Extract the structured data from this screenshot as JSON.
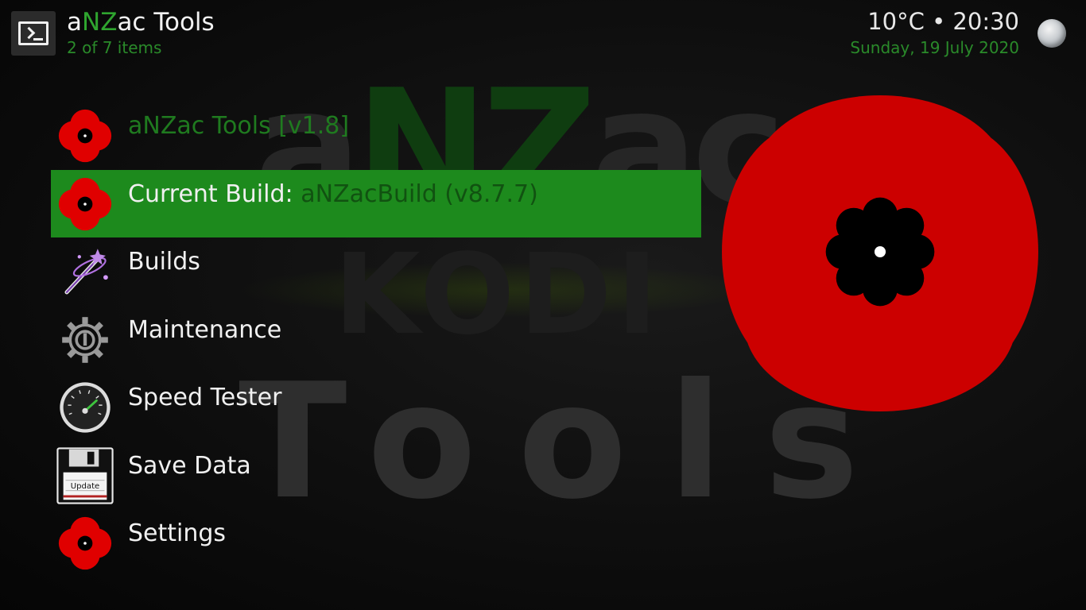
{
  "header": {
    "title_prefix": "a",
    "title_accent": "NZ",
    "title_suffix": "ac Tools",
    "item_count": "2 of 7 items",
    "weather_time": "10°C • 20:30",
    "date": "Sunday, 19 July 2020",
    "icons": {
      "app": "terminal-icon",
      "weather": "moon-icon"
    }
  },
  "fanart": {
    "top_prefix": "a",
    "top_accent": "NZ",
    "top_suffix": "ac",
    "middle": "KODI",
    "bottom": "Tools"
  },
  "menu": {
    "items": [
      {
        "label": "aNZac Tools [v1.8]",
        "icon": "poppy-icon"
      },
      {
        "label": "Current Build:",
        "label_dim": "aNZacBuild (v8.7.7)",
        "icon": "poppy-icon",
        "focused": true
      },
      {
        "label": "Builds",
        "icon": "magic-wand-icon"
      },
      {
        "label": "Maintenance",
        "icon": "gear-wrench-icon"
      },
      {
        "label": "Speed Tester",
        "icon": "speedometer-icon"
      },
      {
        "label": "Save Data",
        "icon": "floppy-disk-icon",
        "floppy_text": "Update"
      },
      {
        "label": "Settings",
        "icon": "poppy-icon"
      }
    ]
  },
  "colors": {
    "accent": "#1d8a1d",
    "poppy_red": "#cc0000",
    "accent_text": "#2a8a2a"
  }
}
